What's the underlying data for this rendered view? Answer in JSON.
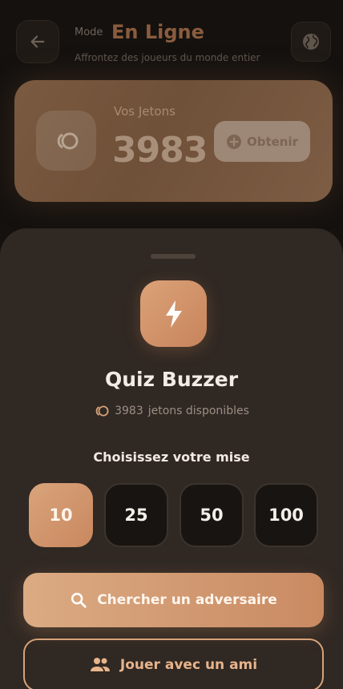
{
  "header": {
    "mode_label": "Mode",
    "mode_title": "En Ligne",
    "subtitle": "Affrontez des joueurs du monde entier"
  },
  "tokens_card": {
    "label": "Vos Jetons",
    "value": "3983",
    "obtain_label": "Obtenir"
  },
  "sheet": {
    "title": "Quiz Buzzer",
    "available_count": "3983",
    "available_suffix": "jetons disponibles",
    "choose_label": "Choisissez votre mise",
    "stakes": [
      "10",
      "25",
      "50",
      "100"
    ],
    "selected_stake": "10",
    "search_label": "Chercher un adversaire",
    "friend_label": "Jouer avec un ami"
  },
  "icons": {
    "back": "arrow-left-icon",
    "globe": "globe-icon",
    "coin": "coins-icon",
    "add": "plus-circle-icon",
    "mode": "lightning-icon",
    "search": "search-icon",
    "friends": "people-icon"
  },
  "colors": {
    "accent": "#d49c73",
    "sheet_bg": "#302823",
    "screen_bg": "#14110f"
  }
}
